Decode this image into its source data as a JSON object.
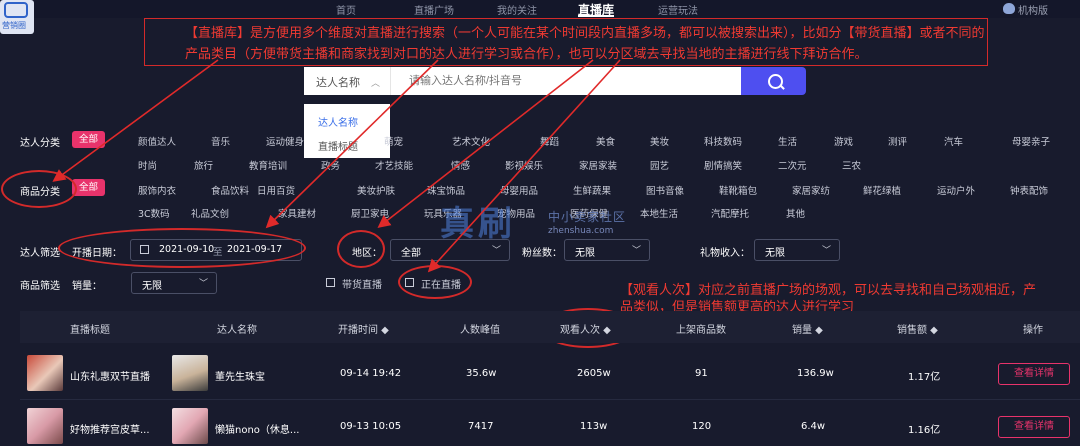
{
  "logo": {
    "text": "营销圈"
  },
  "nav": {
    "items": [
      "首页",
      "直播广场",
      "我的关注",
      "直播库",
      "运营玩法"
    ],
    "active": "直播库",
    "org": "机构版"
  },
  "annotation_top": "【直播库】是方便用多个维度对直播进行搜索（一个人可能在某个时间段内直播多场，都可以被搜索出来），比如分【带货直播】或者不同的产品类目（方便带货主播和商家找到对口的达人进行学习或合作），也可以分区域去寻找当地的主播进行线下拜访合作。",
  "search": {
    "select_value": "达人名称",
    "placeholder": "请输入达人名称/抖音号",
    "dropdown": [
      "达人名称",
      "直播标题"
    ]
  },
  "filters": {
    "talent_label": "达人分类",
    "talent_all": "全部",
    "talent_tags_row1": [
      "颜值达人",
      "音乐",
      "运动健身",
      "",
      "萌宠",
      "艺术文化",
      "舞蹈",
      "美食",
      "美妆",
      "科技数码",
      "生活",
      "游戏",
      "测评",
      "汽车",
      "母婴亲子"
    ],
    "talent_tags_row2": [
      "时尚",
      "旅行",
      "教育培训",
      "政务",
      "才艺技能",
      "情感",
      "影视娱乐",
      "家居家装",
      "园艺",
      "剧情搞笑",
      "二次元",
      "三农"
    ],
    "product_label": "商品分类",
    "product_all": "全部",
    "product_tags_row1": [
      "服饰内衣",
      "食品饮料",
      "日用百货",
      "美妆护肤",
      "珠宝饰品",
      "母婴用品",
      "生鲜蔬果",
      "图书音像",
      "鞋靴箱包",
      "家居家纺",
      "鲜花绿植",
      "运动户外",
      "钟表配饰"
    ],
    "product_tags_row2": [
      "3C数码",
      "礼品文创",
      "家具建材",
      "厨卫家电",
      "玩具乐器",
      "宠物用品",
      "医药保健",
      "本地生活",
      "汽配摩托",
      "其他"
    ],
    "screen_label": "达人筛选",
    "date_label": "开播日期：",
    "date_from": "2021-09-10",
    "date_sep": "至",
    "date_to": "2021-09-17",
    "region_label": "地区：",
    "region_value": "全部",
    "fans_label": "粉丝数：",
    "fans_value": "无限",
    "gift_label": "礼物收入：",
    "gift_value": "无限",
    "goods_screen_label": "商品筛选",
    "sales_label": "销量：",
    "sales_value": "无限",
    "check_goods": "带货直播",
    "check_live": "正在直播"
  },
  "annotation_mid": "【观看人次】对应之前直播广场的场观，可以去寻找和自己场观相近，产品类似，但是销售额更高的达人进行学习",
  "watermark": {
    "main": "真刷",
    "sub": "中小卖家社区",
    "url": "zhenshua.com"
  },
  "table": {
    "headers": [
      "直播标题",
      "达人名称",
      "开播时间 ◆",
      "人数峰值",
      "观看人次 ◆",
      "上架商品数",
      "销量 ◆",
      "销售额 ◆",
      "操作"
    ],
    "rows": [
      {
        "title": "山东礼惠双节直播",
        "talent": "董先生珠宝",
        "time": "09-14 19:42",
        "peak": "35.6w",
        "views": "2605w",
        "goods": "91",
        "sales": "136.9w",
        "revenue": "1.17亿",
        "action": "查看详情"
      },
      {
        "title": "好物推荐宫皮草...",
        "talent": "懒猫nono（休息...",
        "time": "09-13 10:05",
        "peak": "7417",
        "views": "113w",
        "goods": "120",
        "sales": "6.4w",
        "revenue": "1.16亿",
        "action": "查看详情"
      }
    ]
  },
  "colors": {
    "accent": "#e8336b",
    "annotation": "#ef3a32",
    "search_button": "#4e4ff0",
    "background": "#181b2d"
  }
}
